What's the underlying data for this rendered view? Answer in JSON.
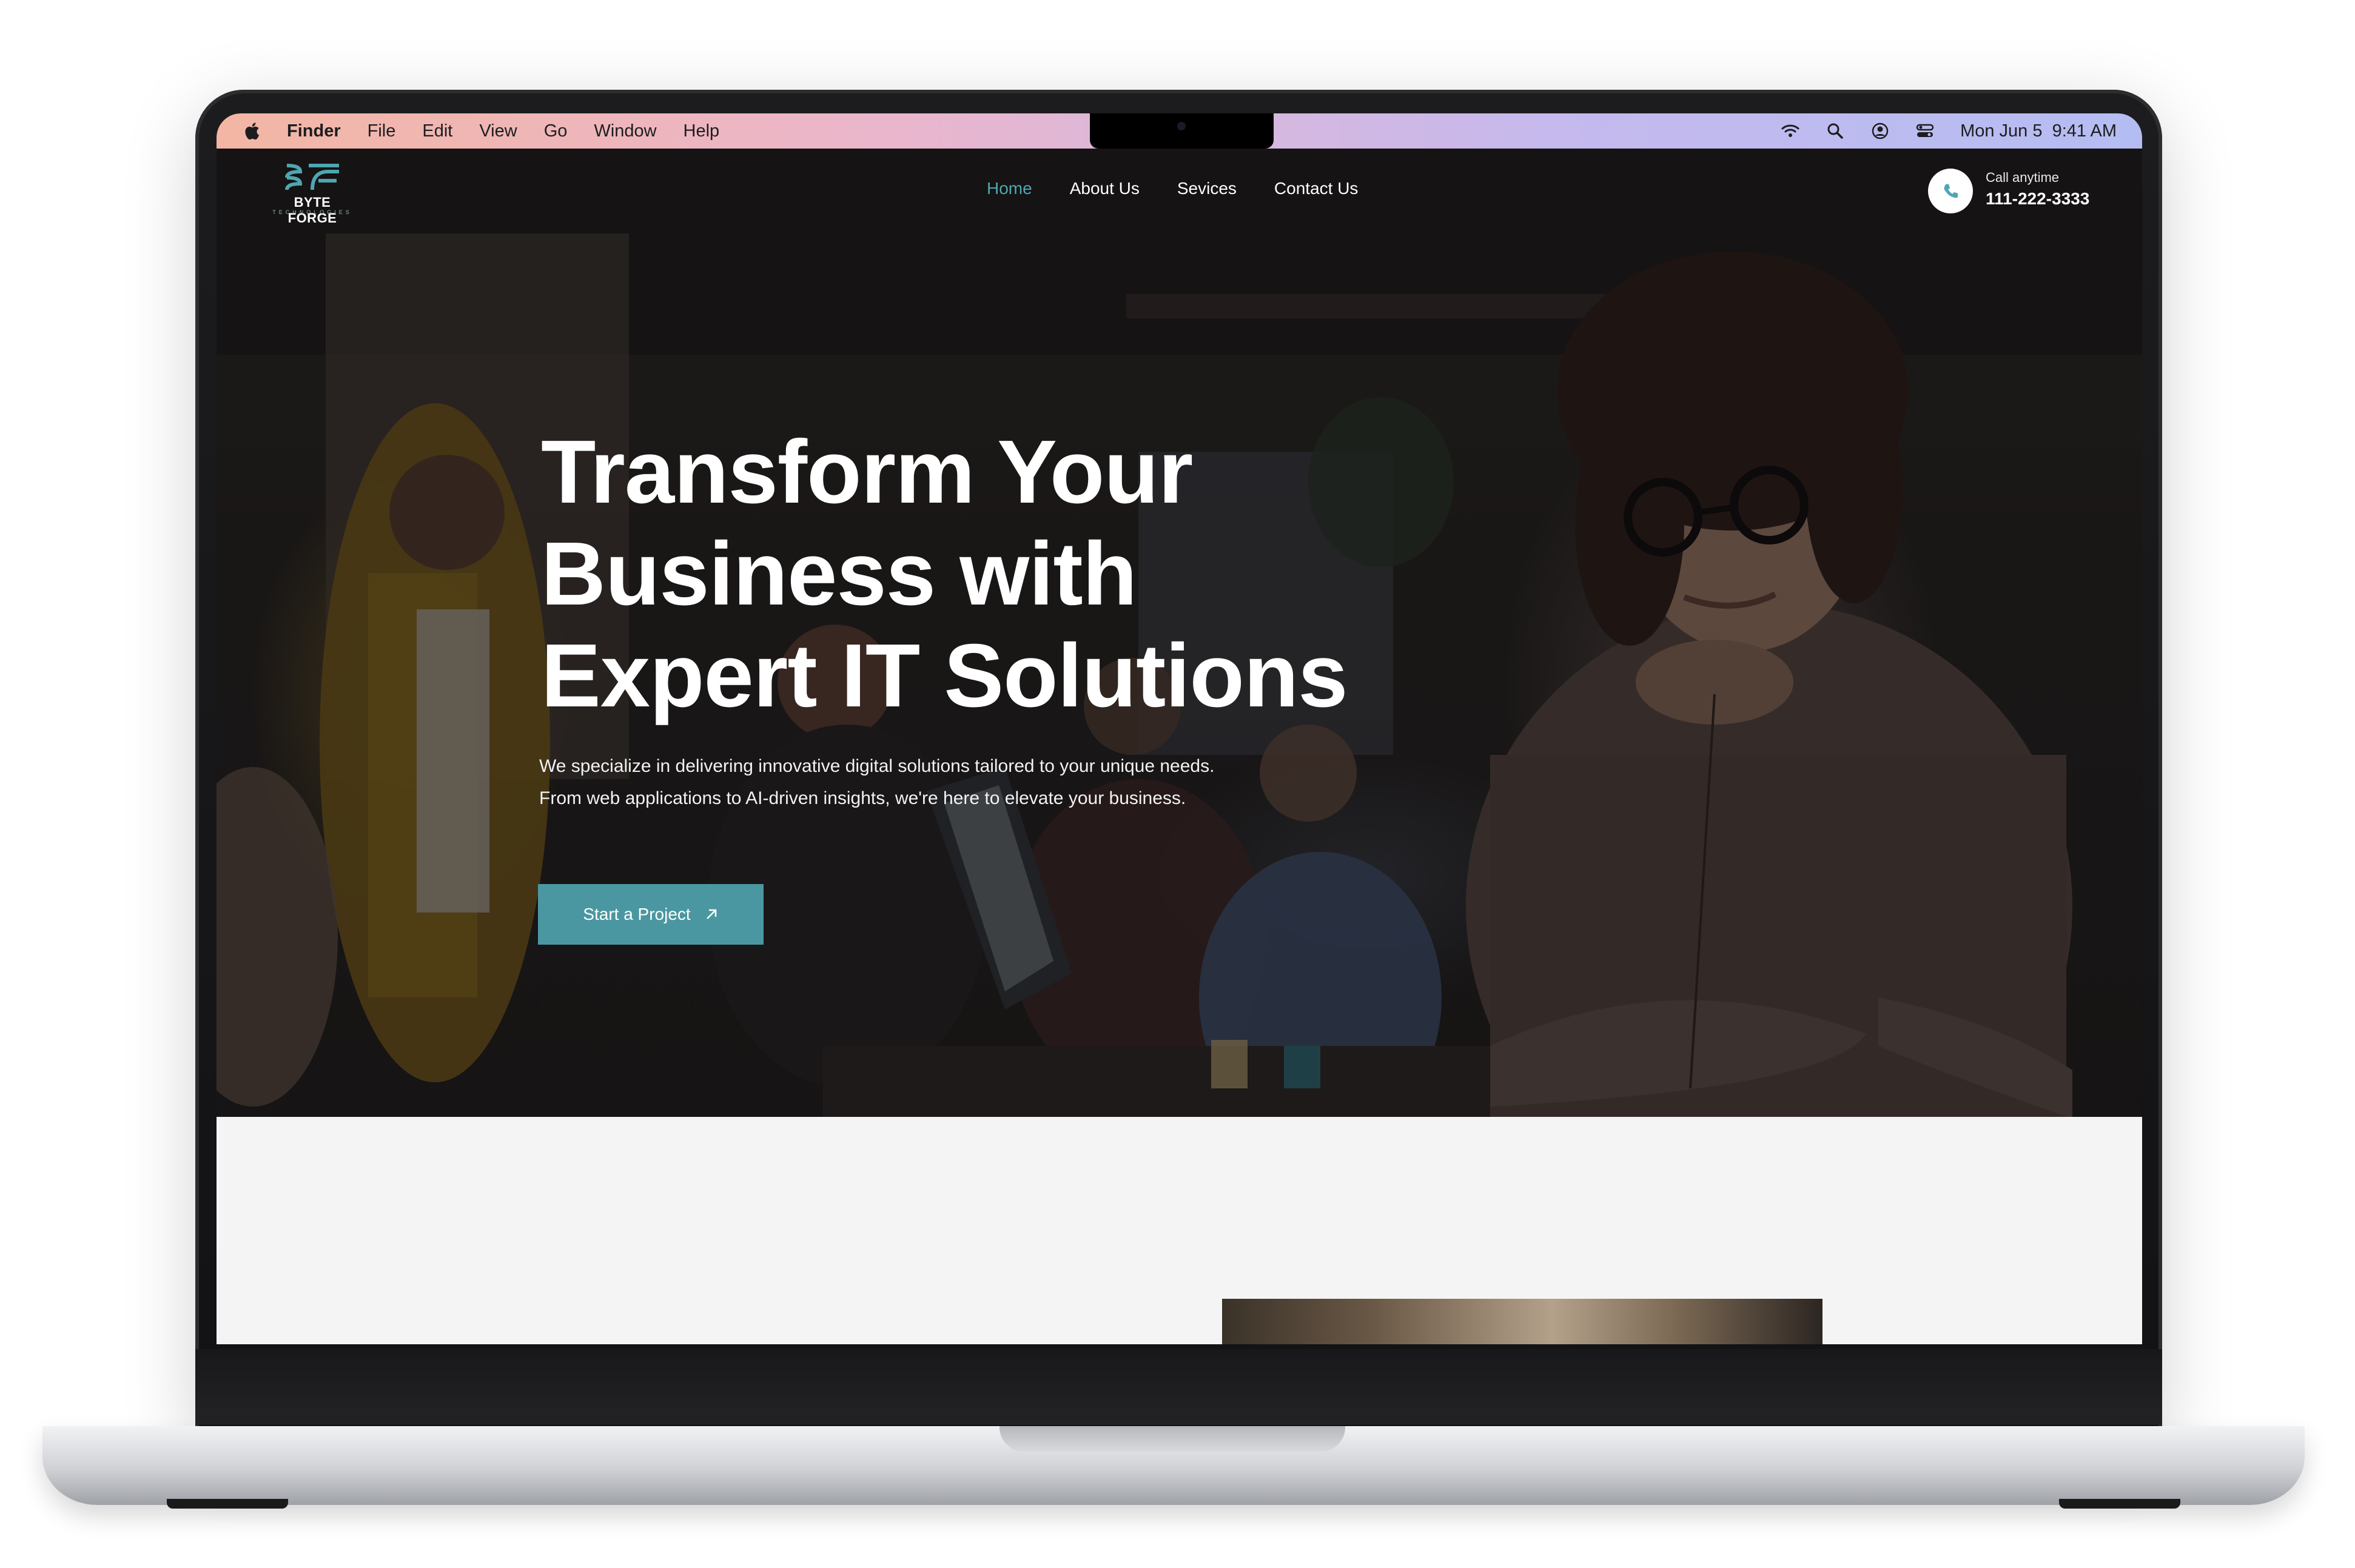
{
  "menubar": {
    "app_name": "Finder",
    "menus": [
      "File",
      "Edit",
      "View",
      "Go",
      "Window",
      "Help"
    ],
    "datetime": "Mon Jun 5  9:41 AM",
    "status_icons": [
      "wifi-icon",
      "search-icon",
      "user-icon",
      "control-center-icon"
    ]
  },
  "site": {
    "logo": {
      "name": "BYTE FORGE",
      "tagline": "TECHNOLOGIES"
    },
    "nav": {
      "links": [
        "Home",
        "About Us",
        "Sevices",
        "Contact Us"
      ],
      "active": "Home"
    },
    "call": {
      "label": "Call anytime",
      "number": "111-222-3333"
    },
    "hero": {
      "headline_lines": [
        "Transform Your",
        "Business with",
        "Expert IT Solutions"
      ],
      "subtext_lines": [
        "We specialize in delivering innovative digital solutions tailored to your unique needs.",
        "From web applications to AI-driven insights, we're here to elevate your business."
      ],
      "cta_label": "Start a Project"
    }
  },
  "colors": {
    "accent": "#4fa6b2",
    "cta_bg": "#4a97a1",
    "hero_overlay": "#1e1b1a",
    "lower_bg": "#f4f4f4"
  }
}
